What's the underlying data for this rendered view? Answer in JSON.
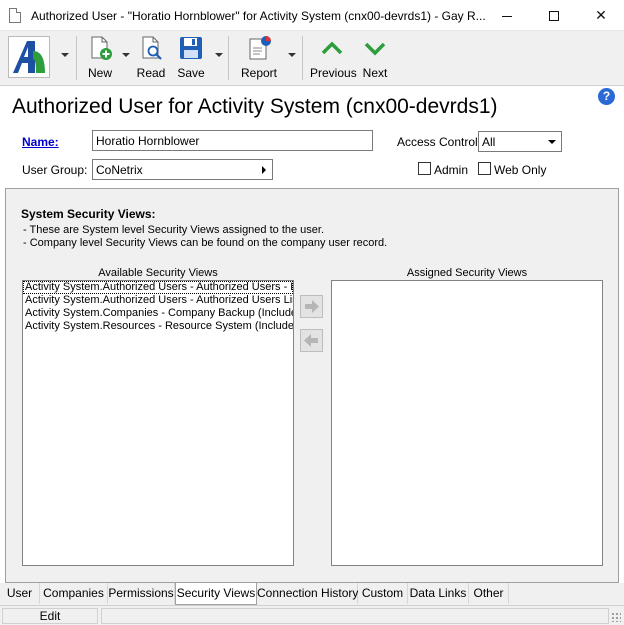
{
  "window": {
    "title": "Authorized User - \"Horatio Hornblower\" for Activity System (cnx00-devrds1) - Gay R...",
    "minimize_icon": "minimize-icon",
    "maximize_icon": "maximize-icon",
    "close_glyph": "✕"
  },
  "toolbar": {
    "new_label": "New",
    "read_label": "Read",
    "save_label": "Save",
    "report_label": "Report",
    "previous_label": "Previous",
    "next_label": "Next"
  },
  "header": {
    "title": "Authorized User for Activity System (cnx00-devrds1)",
    "help_glyph": "?"
  },
  "form": {
    "name_label": "Name:",
    "name_value": "Horatio Hornblower",
    "user_group_label": "User Group:",
    "user_group_value": "CoNetrix",
    "access_control_label": "Access Control:",
    "access_control_value": "All",
    "admin_label": "Admin",
    "web_only_label": "Web Only"
  },
  "security_views": {
    "section_title": "System Security Views:",
    "notes": [
      "- These are System level Security Views assigned to the user.",
      "- Company level Security Views can be found on the company user record."
    ],
    "available_label": "Available Security Views",
    "assigned_label": "Assigned Security Views",
    "available_items": [
      "Activity System.Authorized Users - Authorized Users - Li",
      "Activity System.Authorized Users - Authorized Users Lim",
      "Activity System.Companies - Company Backup (Include)",
      "Activity System.Resources - Resource System (Include)"
    ],
    "assigned_items": []
  },
  "tabs": [
    {
      "label": "User"
    },
    {
      "label": "Companies"
    },
    {
      "label": "Permissions"
    },
    {
      "label": "Security Views"
    },
    {
      "label": "Connection History"
    },
    {
      "label": "Custom"
    },
    {
      "label": "Data Links"
    },
    {
      "label": "Other"
    }
  ],
  "statusbar": {
    "edit_label": "Edit"
  },
  "colors": {
    "accent_green": "#2e9e3c",
    "link_blue": "#0000cc",
    "save_blue": "#1f5fb5"
  }
}
